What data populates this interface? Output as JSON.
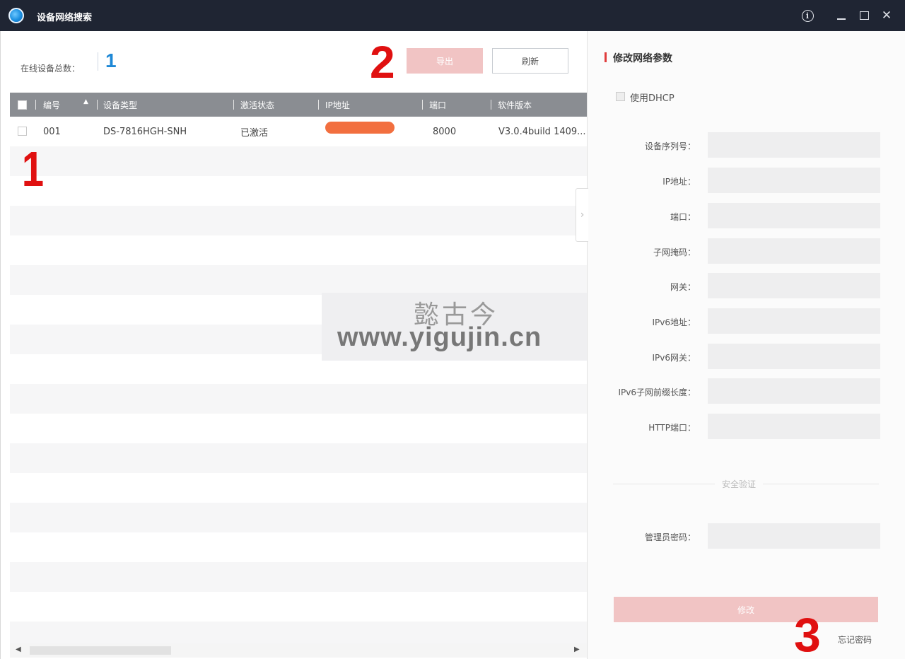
{
  "window": {
    "title": "设备网络搜索"
  },
  "left": {
    "online_label": "在线设备总数：",
    "online_count": "1",
    "export_label": "导出",
    "refresh_label": "刷新",
    "annotation_1": "1",
    "annotation_2": "2"
  },
  "table": {
    "headers": [
      "编号",
      "设备类型",
      "激活状态",
      "IP地址",
      "端口",
      "软件版本"
    ],
    "rows": [
      {
        "id": "001",
        "type": "DS-7816HGH-SNH",
        "status": "已激活",
        "port": "8000",
        "version": "V3.0.4build 1409..."
      }
    ]
  },
  "watermark": {
    "cn": "懿古今",
    "url": "www.yigujin.cn"
  },
  "right": {
    "title": "修改网络参数",
    "dhcp_label": "使用DHCP",
    "fields": [
      "设备序列号：",
      "IP地址：",
      "端口：",
      "子网掩码：",
      "网关：",
      "IPv6地址：",
      "IPv6网关：",
      "IPv6子网前缀长度：",
      "HTTP端口："
    ],
    "divider_text": "安全验证",
    "password_label": "管理员密码：",
    "modify_label": "修改",
    "forgot_label": "忘记密码",
    "annotation_3": "3"
  },
  "colors": {
    "titlebar": "#1f2533",
    "accent_blue": "#1e88d6",
    "annotation_red": "#e01010",
    "disabled_button": "#f1c4c4",
    "table_header": "#8a8d92"
  }
}
